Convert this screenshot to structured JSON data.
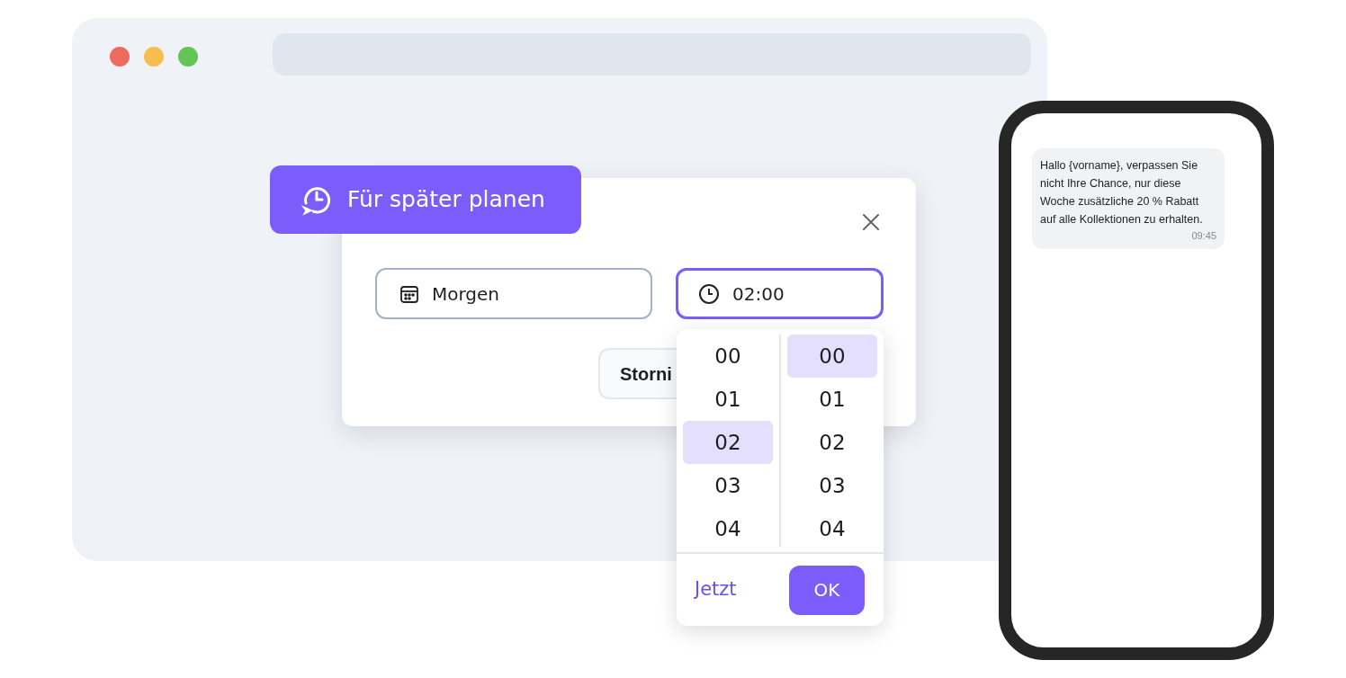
{
  "badge": {
    "label": "Für später planen"
  },
  "dialog": {
    "date_field": {
      "value": "Morgen"
    },
    "time_field": {
      "value": "02:00",
      "focused": true
    },
    "cancel_button": "Storni"
  },
  "time_picker": {
    "hours": [
      {
        "label": "00",
        "selected": false
      },
      {
        "label": "01",
        "selected": false
      },
      {
        "label": "02",
        "selected": true
      },
      {
        "label": "03",
        "selected": false
      },
      {
        "label": "04",
        "selected": false
      }
    ],
    "minutes": [
      {
        "label": "00",
        "selected": true
      },
      {
        "label": "01",
        "selected": false
      },
      {
        "label": "02",
        "selected": false
      },
      {
        "label": "03",
        "selected": false
      },
      {
        "label": "04",
        "selected": false
      }
    ],
    "now_button": "Jetzt",
    "ok_button": "OK"
  },
  "phone": {
    "message": {
      "text": "Hallo {vorname}, verpassen Sie nicht Ihre Chance, nur diese Woche zusätzliche 20 % Rabatt auf alle Kollektionen zu erhalten.",
      "time": "09:45"
    }
  }
}
